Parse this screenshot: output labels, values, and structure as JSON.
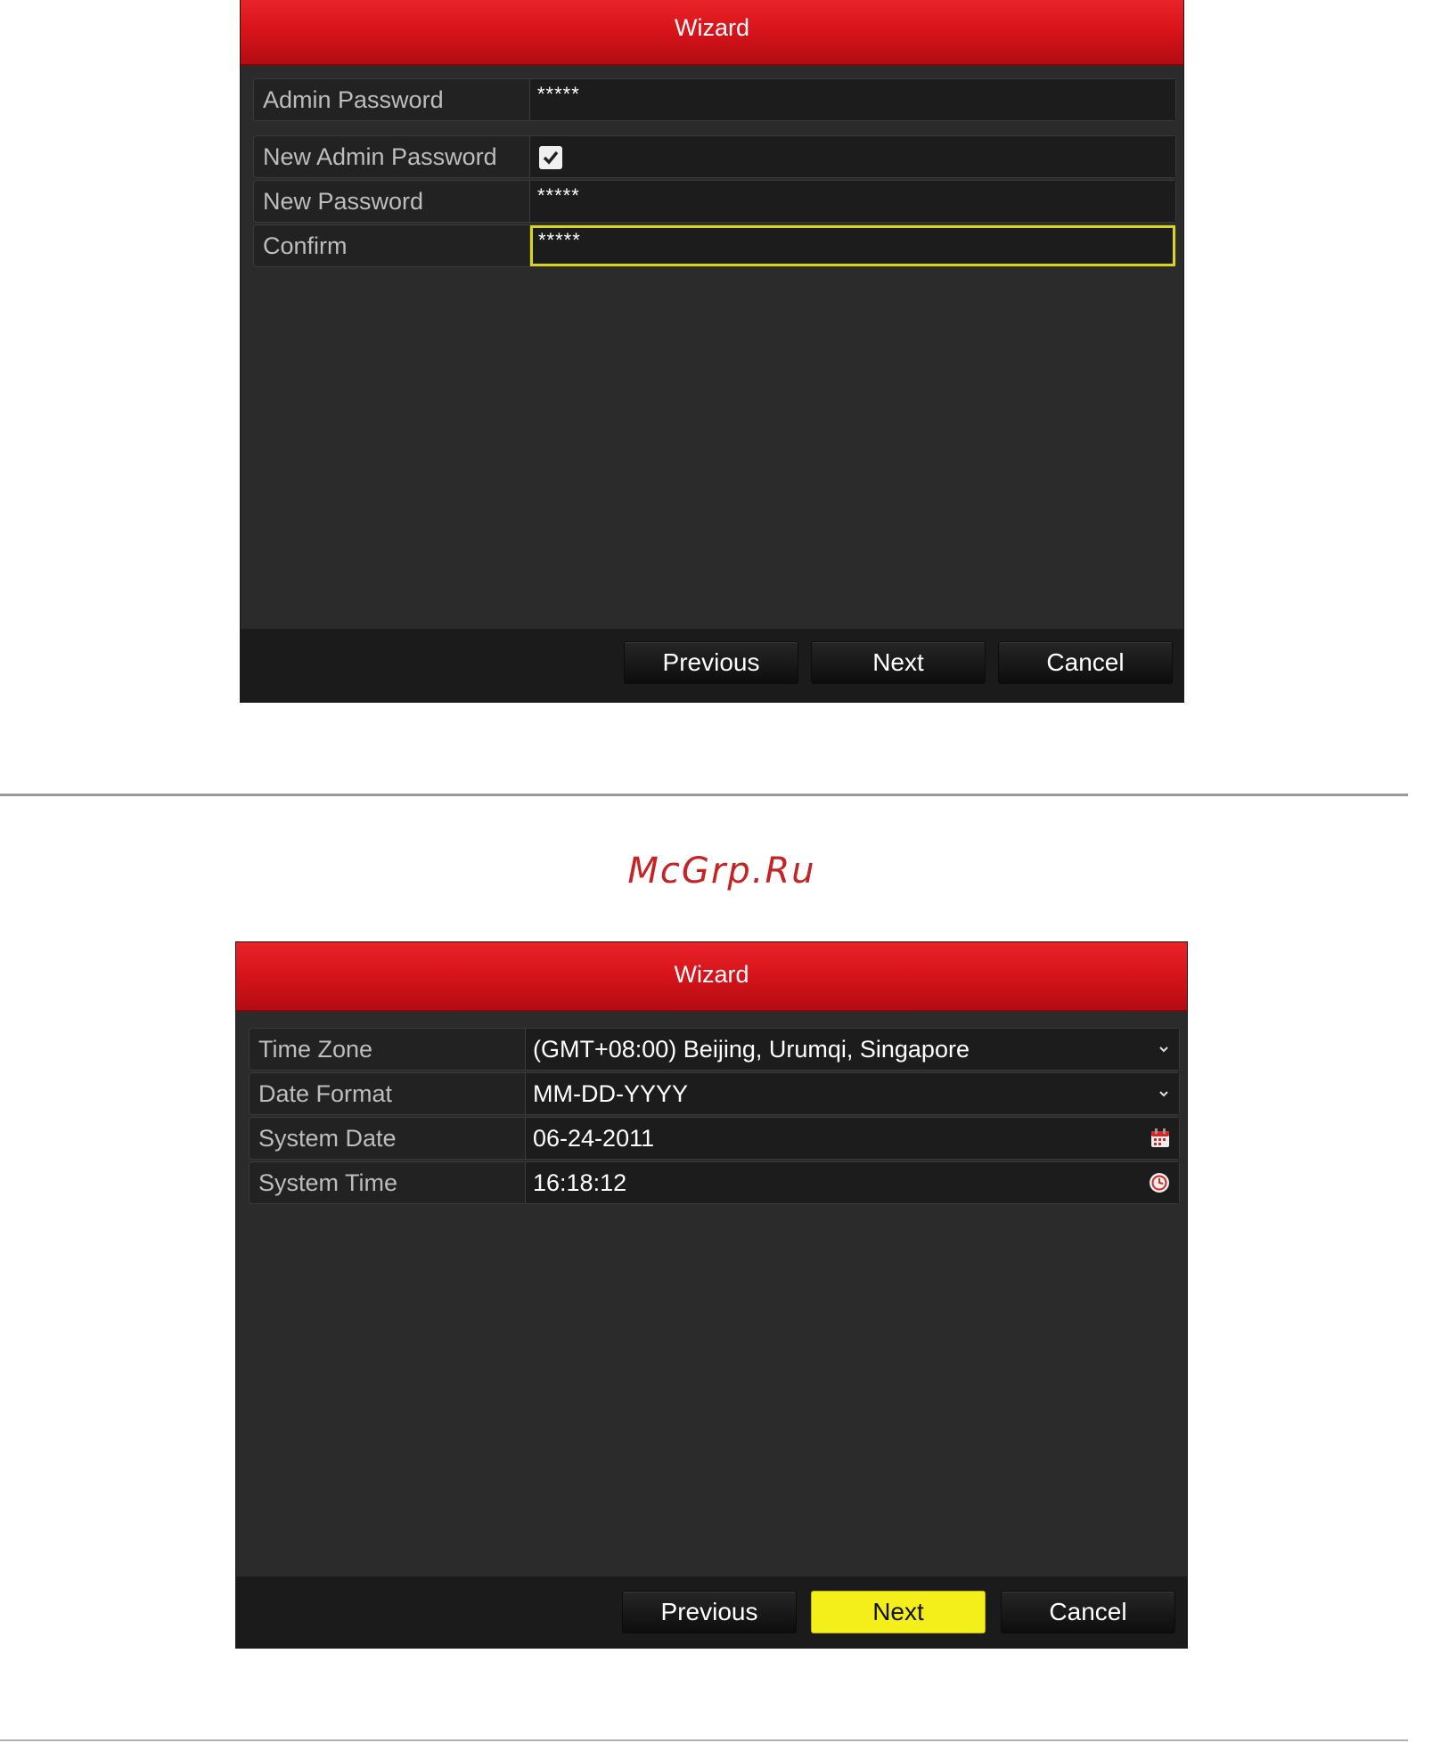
{
  "dialog1": {
    "title": "Wizard",
    "rows_group1": [
      {
        "label": "Admin Password",
        "value": "*****"
      }
    ],
    "rows_group2": [
      {
        "label": "New Admin Password",
        "checked": true
      },
      {
        "label": "New Password",
        "value": "*****"
      },
      {
        "label": "Confirm",
        "value": "*****"
      }
    ],
    "buttons": {
      "previous": "Previous",
      "next": "Next",
      "cancel": "Cancel"
    }
  },
  "watermark": "McGrp.Ru",
  "dialog2": {
    "title": "Wizard",
    "rows": [
      {
        "label": "Time Zone",
        "value": "(GMT+08:00) Beijing, Urumqi, Singapore",
        "icon": "chevron-down-icon"
      },
      {
        "label": "Date Format",
        "value": "MM-DD-YYYY",
        "icon": "chevron-down-icon"
      },
      {
        "label": "System Date",
        "value": "06-24-2011",
        "icon": "calendar-icon"
      },
      {
        "label": "System Time",
        "value": "16:18:12",
        "icon": "clock-icon"
      }
    ],
    "buttons": {
      "previous": "Previous",
      "next": "Next",
      "cancel": "Cancel"
    }
  },
  "colors": {
    "titlebar": "#d9141b",
    "focus_border": "#d7d422",
    "primary_button": "#f4ee1b",
    "watermark": "#c62424"
  }
}
